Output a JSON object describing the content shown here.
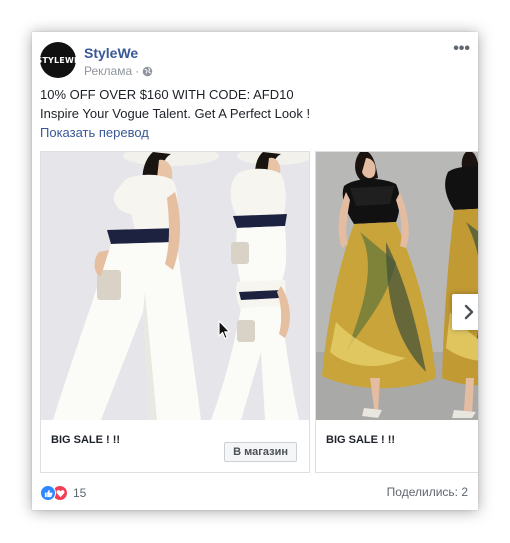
{
  "post": {
    "page_name": "StyleWe",
    "avatar_text": "STYLEWE",
    "sponsored_label": "Реклама",
    "separator": "·",
    "privacy_icon": "globe-icon",
    "more_icon": "•••",
    "text_line1": "10% OFF OVER $160 WITH CODE: AFD10",
    "text_line2": "Inspire Your Vogue Talent. Get A Perfect Look !",
    "translate_link": "Показать перевод"
  },
  "carousel": {
    "cards": [
      {
        "headline": "BIG SALE ! !!",
        "cta": "В магазин",
        "image": "woman in white jumpsuit with black belt"
      },
      {
        "headline": "BIG SALE ! !!",
        "image": "woman in black lace top and yellow floral maxi skirt"
      }
    ],
    "next_icon": "chevron-right-icon"
  },
  "footer": {
    "reactions": [
      "like-icon",
      "love-icon"
    ],
    "reaction_count": "15",
    "shares": "Поделились: 2"
  },
  "colors": {
    "link_blue": "#385898",
    "text": "#1d2129",
    "meta_gray": "#90949c",
    "like_blue": "#2d88ff",
    "love_red": "#f33e58"
  }
}
